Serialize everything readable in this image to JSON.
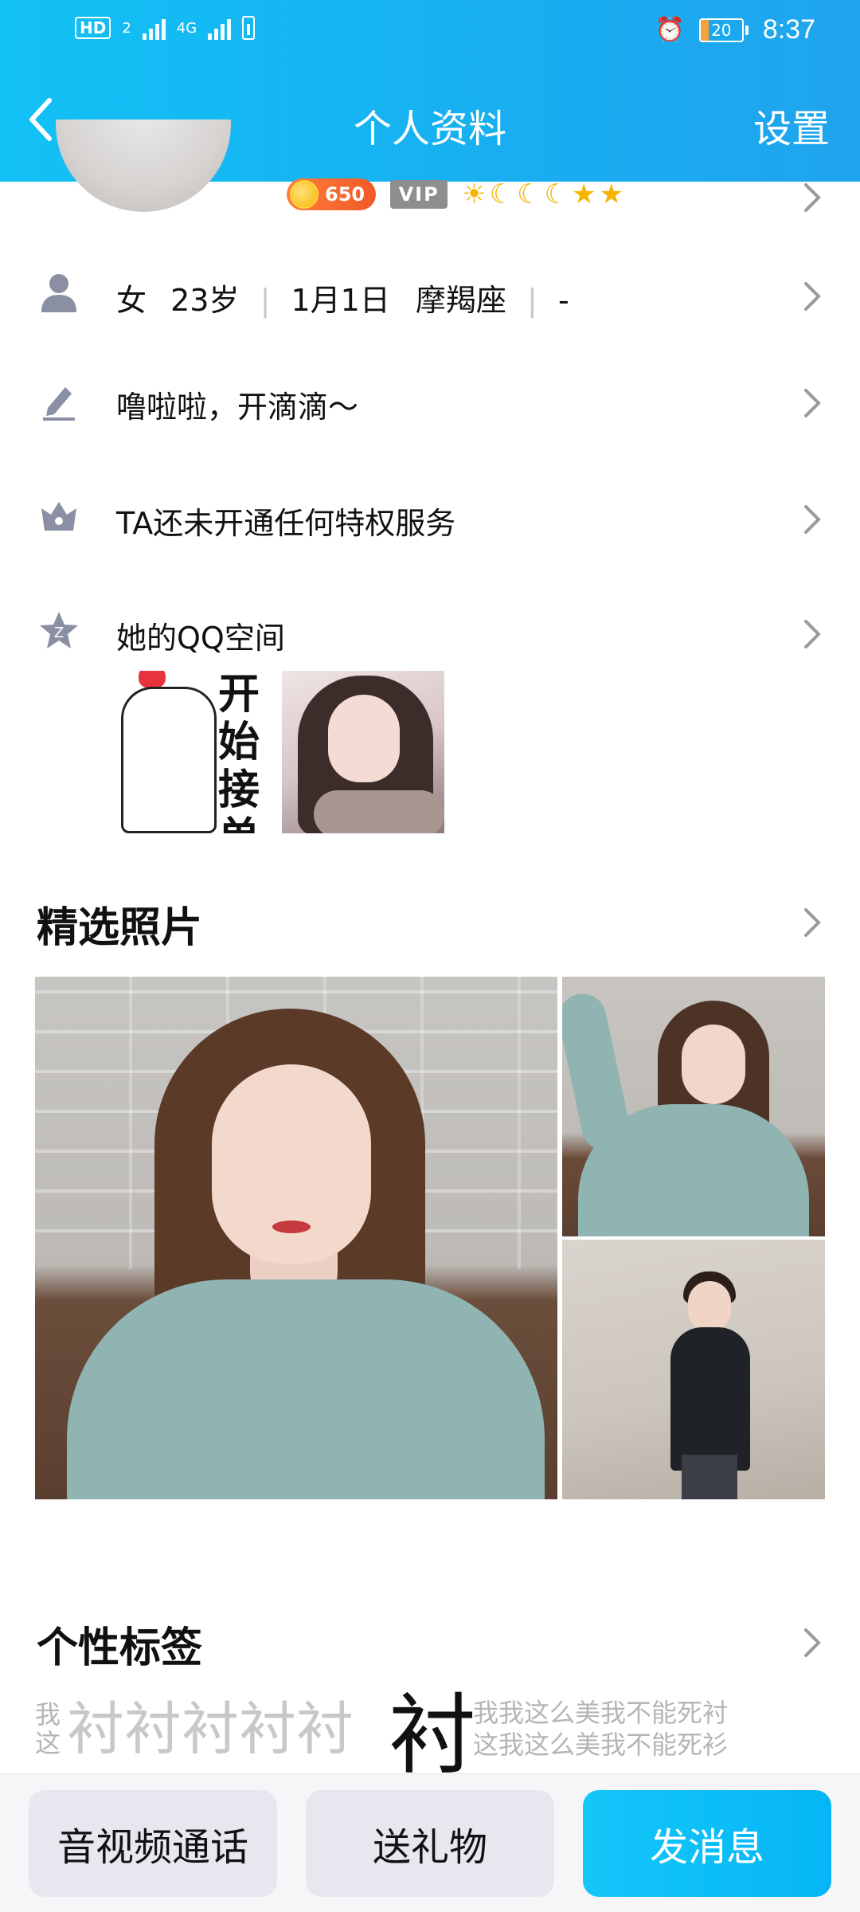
{
  "status_bar": {
    "network": "HD",
    "network_sub": "2",
    "signal_type": "4G",
    "battery": "20",
    "battery_level": 0.2,
    "time": "8:37"
  },
  "nav": {
    "title": "个人资料",
    "settings": "设置",
    "back_icon": "chevron-left-icon"
  },
  "profile_badges": {
    "coins": "650",
    "vip": "VIP",
    "level_icons": [
      "sun",
      "moon",
      "moon",
      "moon",
      "star",
      "star"
    ]
  },
  "info_row": {
    "gender": "女",
    "age": "23岁",
    "birthday": "1月1日",
    "zodiac": "摩羯座",
    "location": "-"
  },
  "signature": "噜啦啦，开滴滴～",
  "privilege": "TA还未开通任何特权服务",
  "qzone": {
    "label": "她的QQ空间",
    "thumb_text": "开始接单"
  },
  "photos": {
    "title": "精选照片"
  },
  "tags": {
    "title": "个性标签",
    "small_left_1": "我",
    "small_left_2": "这",
    "big_repeat": "衬衬衬衬衬",
    "xl": "衬",
    "right_line_1": "我我这么美我不能死衬",
    "right_line_2": "这我这么美我不能死衫"
  },
  "bottom_bar": {
    "call": "音视频通话",
    "gift": "送礼物",
    "message": "发消息"
  },
  "colors": {
    "header_gradient_start": "#12c1f5",
    "header_gradient_end": "#1fa4ee",
    "primary_button": "#05b6f6",
    "icon_gray": "#8a8fa3"
  }
}
